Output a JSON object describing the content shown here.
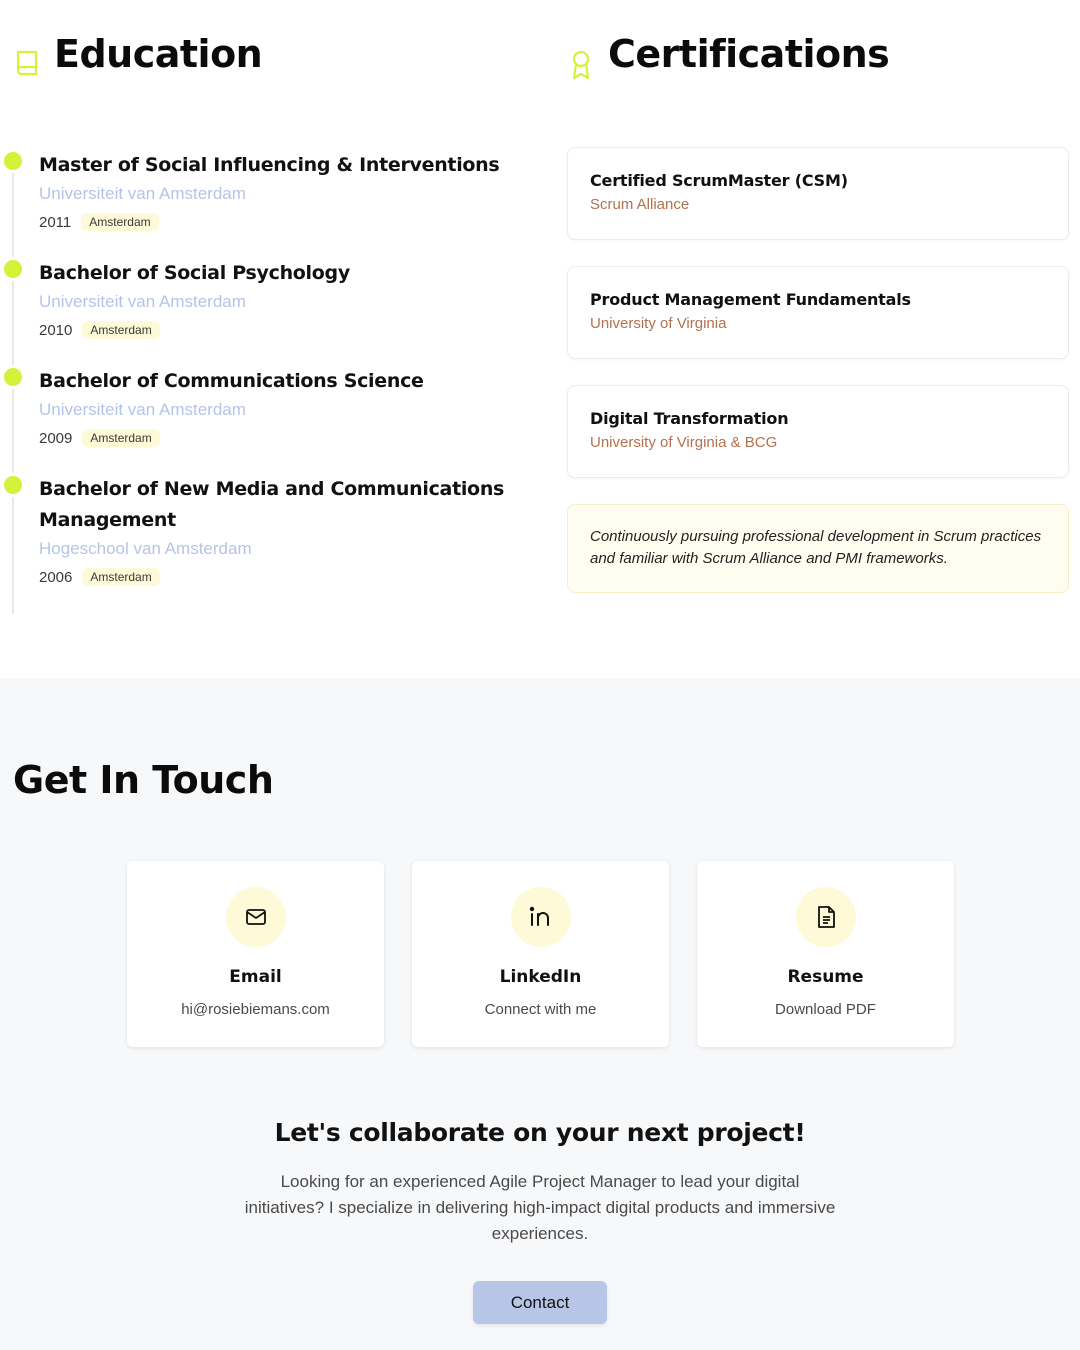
{
  "education": {
    "heading": "Education",
    "icon": "book-icon",
    "items": [
      {
        "title": "Master of Social Influencing & Interventions",
        "school": "Universiteit van Amsterdam",
        "year": "2011",
        "location": "Amsterdam"
      },
      {
        "title": "Bachelor of Social Psychology",
        "school": "Universiteit van Amsterdam",
        "year": "2010",
        "location": "Amsterdam"
      },
      {
        "title": "Bachelor of Communications Science",
        "school": "Universiteit van Amsterdam",
        "year": "2009",
        "location": "Amsterdam"
      },
      {
        "title": "Bachelor of New Media and Communications Management",
        "school": "Hogeschool van Amsterdam",
        "year": "2006",
        "location": "Amsterdam"
      }
    ]
  },
  "certifications": {
    "heading": "Certifications",
    "icon": "award-icon",
    "items": [
      {
        "title": "Certified ScrumMaster (CSM)",
        "org": "Scrum Alliance"
      },
      {
        "title": "Product Management Fundamentals",
        "org": "University of Virginia"
      },
      {
        "title": "Digital Transformation",
        "org": "University of Virginia & BCG"
      }
    ],
    "note": "Continuously pursuing professional development in Scrum practices and familiar with Scrum Alliance and PMI frameworks."
  },
  "contact": {
    "heading": "Get In Touch",
    "cards": [
      {
        "icon": "mail-icon",
        "title": "Email",
        "sub": "hi@rosiebiemans.com"
      },
      {
        "icon": "linkedin-icon",
        "title": "LinkedIn",
        "sub": "Connect with me"
      },
      {
        "icon": "document-icon",
        "title": "Resume",
        "sub": "Download PDF"
      }
    ],
    "collab_title": "Let's collaborate on your next project!",
    "blurb": "Looking for an experienced Agile Project Manager to lead your digital initiatives? I specialize in delivering high-impact digital products and immersive experiences.",
    "button_label": "Contact"
  },
  "colors": {
    "accent_lime": "#d3f23a",
    "school_blue": "#b5c4e6",
    "org_brown": "#b3714f",
    "badge_bg": "#fef9d6",
    "button_bg": "#b7c5e6"
  }
}
